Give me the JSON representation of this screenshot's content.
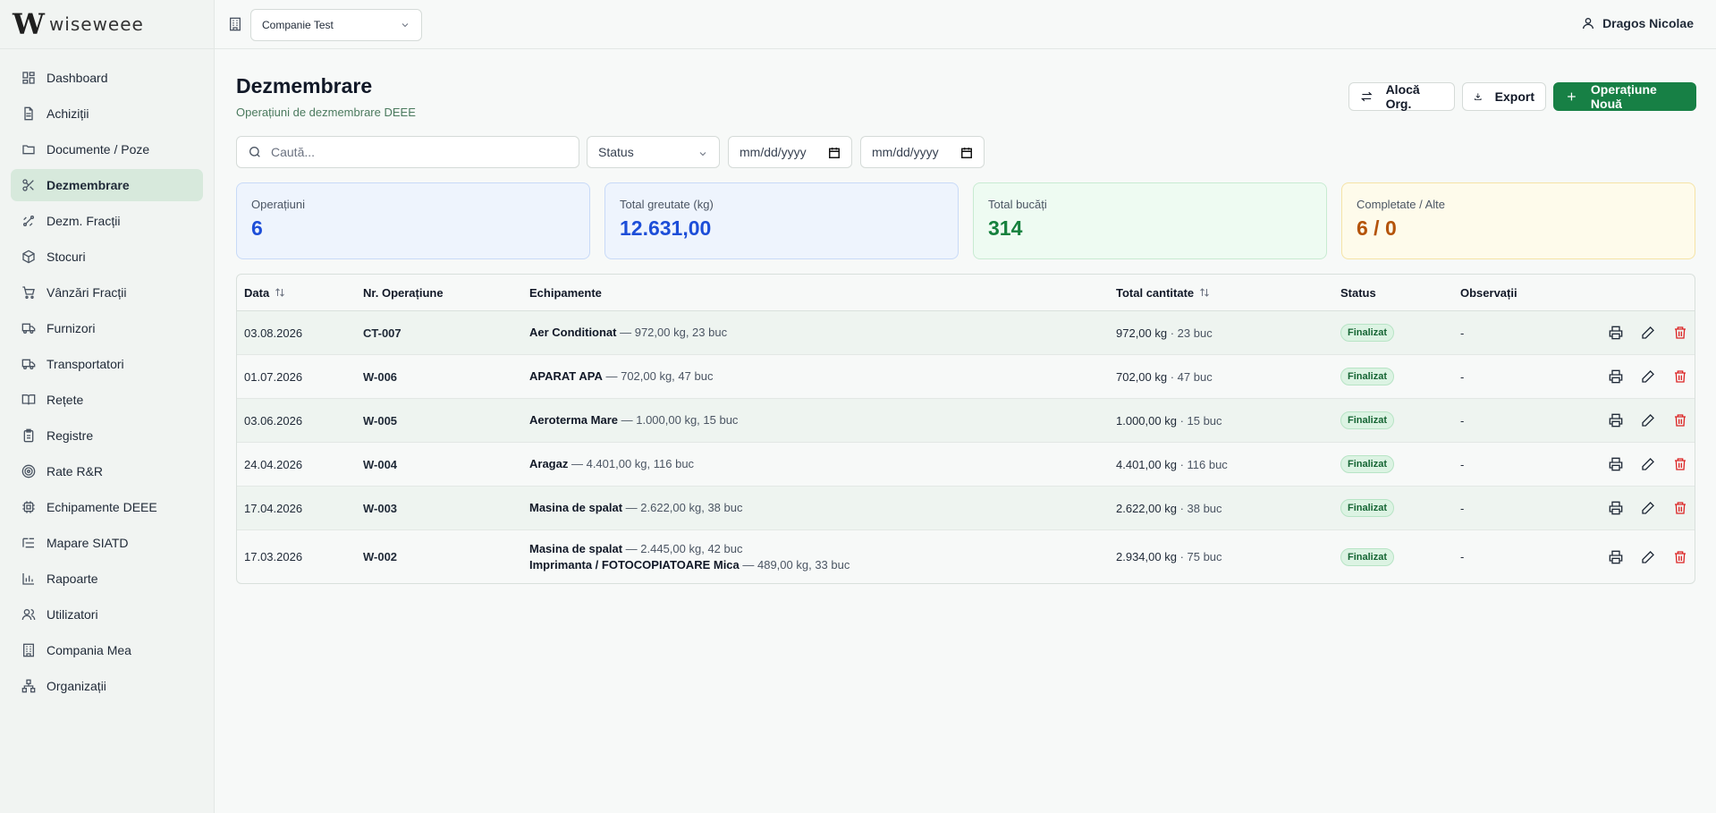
{
  "brand": {
    "mark": "W",
    "name": "wiseweee"
  },
  "sidebar": {
    "items": [
      {
        "label": "Dashboard",
        "icon": "dashboard-icon"
      },
      {
        "label": "Achiziții",
        "icon": "file-icon"
      },
      {
        "label": "Documente / Poze",
        "icon": "folder-icon"
      },
      {
        "label": "Dezmembrare",
        "icon": "scissors-icon",
        "active": true
      },
      {
        "label": "Dezm. Fracții",
        "icon": "split-icon"
      },
      {
        "label": "Stocuri",
        "icon": "box-icon"
      },
      {
        "label": "Vânzări Fracții",
        "icon": "cart-icon"
      },
      {
        "label": "Furnizori",
        "icon": "truck-icon"
      },
      {
        "label": "Transportatori",
        "icon": "truck-icon"
      },
      {
        "label": "Rețete",
        "icon": "book-icon"
      },
      {
        "label": "Registre",
        "icon": "clipboard-icon"
      },
      {
        "label": "Rate R&R",
        "icon": "target-icon"
      },
      {
        "label": "Echipamente DEEE",
        "icon": "cpu-icon"
      },
      {
        "label": "Mapare SIATD",
        "icon": "list-tree-icon"
      },
      {
        "label": "Rapoarte",
        "icon": "bar-chart-icon"
      },
      {
        "label": "Utilizatori",
        "icon": "users-icon"
      },
      {
        "label": "Compania Mea",
        "icon": "building-icon"
      },
      {
        "label": "Organizații",
        "icon": "network-icon"
      }
    ]
  },
  "topbar": {
    "company": "Companie Test",
    "user": "Dragos Nicolae"
  },
  "page": {
    "title": "Dezmembrare",
    "subtitle": "Operațiuni de dezmembrare DEEE",
    "buttons": {
      "alloc": "Alocă Org.",
      "export": "Export",
      "new_op": "Operațiune Nouă"
    }
  },
  "filters": {
    "search_placeholder": "Caută...",
    "status": "Status",
    "date_from": "mm/dd/yyyy",
    "date_to": "mm/dd/yyyy"
  },
  "stats": [
    {
      "label": "Operațiuni",
      "value": "6"
    },
    {
      "label": "Total greutate (kg)",
      "value": "12.631,00"
    },
    {
      "label": "Total bucăți",
      "value": "314"
    },
    {
      "label": "Completate / Alte",
      "value": "6 / 0"
    }
  ],
  "table": {
    "headers": {
      "date": "Data",
      "nr": "Nr. Operațiune",
      "equipment": "Echipamente",
      "total": "Total cantitate",
      "status": "Status",
      "notes": "Observații"
    },
    "rows": [
      {
        "date": "03.08.2026",
        "nr": "CT-007",
        "equipment": [
          {
            "name": "Aer Conditionat",
            "detail": " — 972,00 kg, 23 buc"
          }
        ],
        "kg": "972,00 kg",
        "buc": " · 23 buc",
        "status": "Finalizat",
        "notes": "-"
      },
      {
        "date": "01.07.2026",
        "nr": "W-006",
        "equipment": [
          {
            "name": "APARAT APA",
            "detail": " — 702,00 kg, 47 buc"
          }
        ],
        "kg": "702,00 kg",
        "buc": " · 47 buc",
        "status": "Finalizat",
        "notes": "-"
      },
      {
        "date": "03.06.2026",
        "nr": "W-005",
        "equipment": [
          {
            "name": "Aeroterma Mare",
            "detail": " — 1.000,00 kg, 15 buc"
          }
        ],
        "kg": "1.000,00 kg",
        "buc": " · 15 buc",
        "status": "Finalizat",
        "notes": "-"
      },
      {
        "date": "24.04.2026",
        "nr": "W-004",
        "equipment": [
          {
            "name": "Aragaz",
            "detail": " — 4.401,00 kg, 116 buc"
          }
        ],
        "kg": "4.401,00 kg",
        "buc": " · 116 buc",
        "status": "Finalizat",
        "notes": "-"
      },
      {
        "date": "17.04.2026",
        "nr": "W-003",
        "equipment": [
          {
            "name": "Masina de spalat",
            "detail": " — 2.622,00 kg, 38 buc"
          }
        ],
        "kg": "2.622,00 kg",
        "buc": " · 38 buc",
        "status": "Finalizat",
        "notes": "-"
      },
      {
        "date": "17.03.2026",
        "nr": "W-002",
        "equipment": [
          {
            "name": "Masina de spalat",
            "detail": " — 2.445,00 kg, 42 buc"
          },
          {
            "name": "Imprimanta / FOTOCOPIATOARE Mica",
            "detail": " — 489,00 kg, 33 buc"
          }
        ],
        "kg": "2.934,00 kg",
        "buc": " · 75 buc",
        "status": "Finalizat",
        "notes": "-"
      }
    ]
  }
}
